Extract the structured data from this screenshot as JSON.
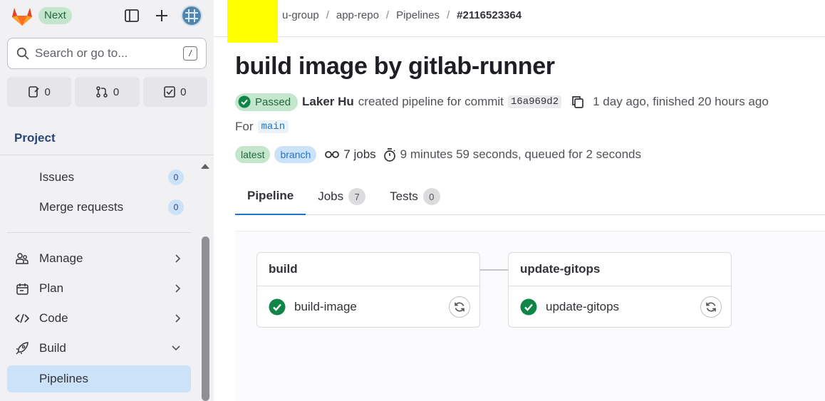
{
  "sidebar": {
    "next_badge": "Next",
    "search_placeholder": "Search or go to...",
    "search_shortcut": "/",
    "counters": {
      "issues": "0",
      "merge_requests": "0",
      "todos": "0"
    },
    "project_title": "Project",
    "sub_items": [
      {
        "label": "Issues",
        "count": "0"
      },
      {
        "label": "Merge requests",
        "count": "0"
      }
    ],
    "nav": [
      {
        "label": "Manage"
      },
      {
        "label": "Plan"
      },
      {
        "label": "Code"
      },
      {
        "label": "Build"
      },
      {
        "label": "Pipelines"
      }
    ]
  },
  "breadcrumb": {
    "group": "u-group",
    "repo": "app-repo",
    "section": "Pipelines",
    "current": "#2116523364"
  },
  "pipeline": {
    "title": "build image by gitlab-runner",
    "status": "Passed",
    "author": "Laker Hu",
    "created_text": "created pipeline for commit",
    "commit_sha": "16a969d2",
    "time_text": "1 day ago, finished 20 hours ago",
    "for_label": "For",
    "branch": "main",
    "tags": [
      "latest",
      "branch"
    ],
    "jobs_text": "7 jobs",
    "duration_text": "9 minutes 59 seconds, queued for 2 seconds"
  },
  "tabs": [
    {
      "label": "Pipeline",
      "count": null
    },
    {
      "label": "Jobs",
      "count": "7"
    },
    {
      "label": "Tests",
      "count": "0"
    }
  ],
  "stages": [
    {
      "name": "build",
      "job": "build-image"
    },
    {
      "name": "update-gitops",
      "job": "update-gitops"
    }
  ],
  "colors": {
    "success": "#108548",
    "accent": "#1f75cb",
    "redaction": "#ffff00"
  }
}
